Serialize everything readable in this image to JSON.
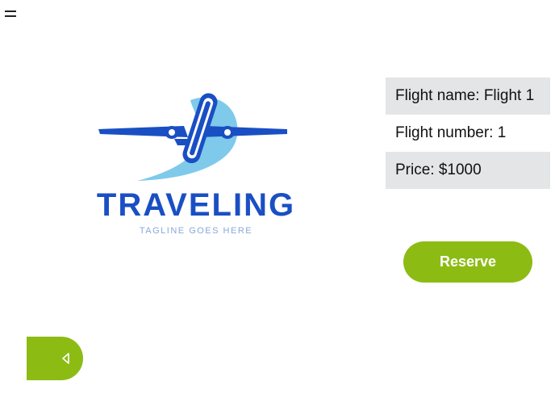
{
  "menu": {
    "icon": "hamburger-icon"
  },
  "logo": {
    "title": "TRAVELING",
    "tagline": "TAGLINE GOES HERE",
    "colors": {
      "blue": "#1a4fc4",
      "sky": "#7fcaea",
      "tagline": "#8aa8d8"
    }
  },
  "flight": {
    "name_label": "Flight name: Flight 1",
    "number_label": "Flight number: 1",
    "price_label": "Price: $1000"
  },
  "actions": {
    "reserve_label": "Reserve",
    "back_icon": "caret-left-icon"
  },
  "colors": {
    "accent": "#8cbc14",
    "row_shade": "#e4e5e6"
  }
}
